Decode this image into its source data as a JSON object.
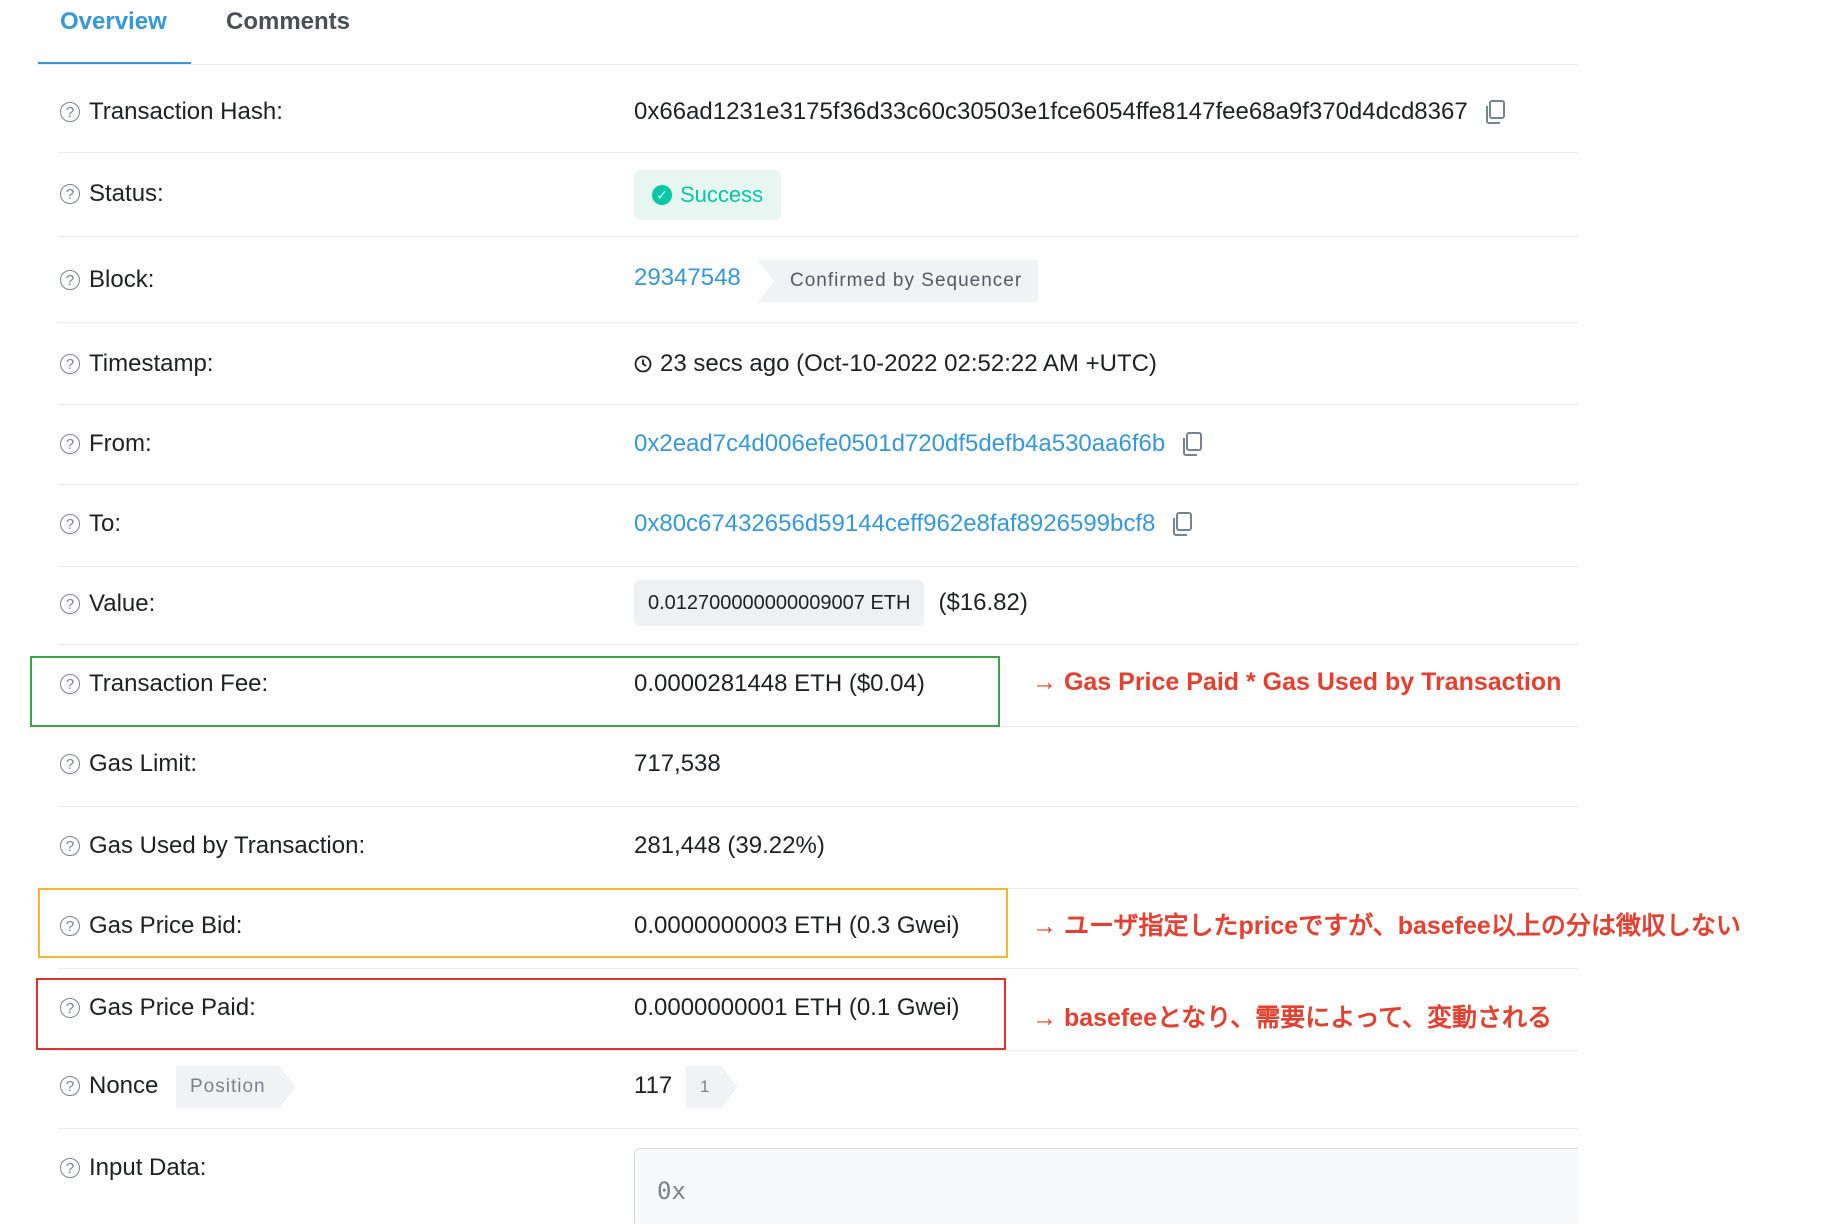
{
  "tabs": [
    {
      "label": "Overview",
      "active": true
    },
    {
      "label": "Comments",
      "active": false
    }
  ],
  "rows": {
    "tx_hash": {
      "label": "Transaction Hash:",
      "value": "0x66ad1231e3175f36d33c60c30503e1fce6054ffe8147fee68a9f370d4dcd8367"
    },
    "status": {
      "label": "Status:",
      "value": "Success"
    },
    "block": {
      "label": "Block:",
      "value": "29347548",
      "badge": "Confirmed by Sequencer"
    },
    "timestamp": {
      "label": "Timestamp:",
      "value": "23 secs ago (Oct-10-2022 02:52:22 AM +UTC)"
    },
    "from": {
      "label": "From:",
      "value": "0x2ead7c4d006efe0501d720df5defb4a530aa6f6b"
    },
    "to": {
      "label": "To:",
      "value": "0x80c67432656d59144ceff962e8faf8926599bcf8"
    },
    "value": {
      "label": "Value:",
      "value": "0.012700000000009007 ETH",
      "usd": "($16.82)"
    },
    "tx_fee": {
      "label": "Transaction Fee:",
      "value": "0.0000281448 ETH ($0.04)"
    },
    "gas_limit": {
      "label": "Gas Limit:",
      "value": "717,538"
    },
    "gas_used": {
      "label": "Gas Used by Transaction:",
      "value": "281,448 (39.22%)"
    },
    "gas_bid": {
      "label": "Gas Price Bid:",
      "value": "0.0000000003 ETH (0.3 Gwei)"
    },
    "gas_paid": {
      "label": "Gas Price Paid:",
      "value": "0.0000000001 ETH (0.1 Gwei)"
    },
    "nonce": {
      "label": "Nonce",
      "badge": "Position",
      "value": "117",
      "position": "1"
    },
    "input": {
      "label": "Input Data:",
      "value": "0x"
    }
  },
  "annotations": {
    "tx_fee": "→ Gas Price Paid * Gas Used by Transaction",
    "gas_bid": "→ ユーザ指定したpriceですが、basefee以上の分は徴収しない",
    "gas_paid": "→ basefeeとなり、需要によって、変動される"
  },
  "colors": {
    "link": "#3498db",
    "success": "#00c9a7",
    "annotation": "#e43f2f",
    "box_fee": "#3aa54a",
    "box_bid": "#f5b731",
    "box_paid": "#e0332c"
  },
  "icons": {
    "help": "question-circle-icon",
    "copy": "copy-icon",
    "success": "check-circle-icon",
    "clock": "clock-icon"
  },
  "help_glyph": "?",
  "success_glyph": "✓"
}
